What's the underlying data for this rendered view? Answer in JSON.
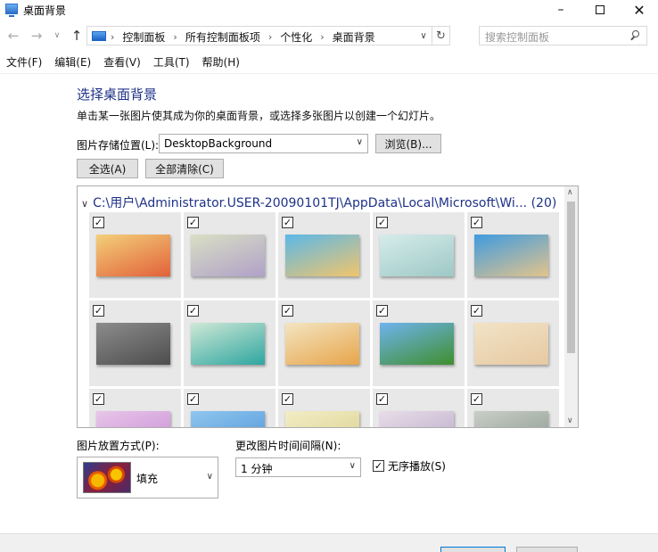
{
  "window": {
    "title": "桌面背景",
    "minimize": "–",
    "close": "✕"
  },
  "nav": {
    "back": "←",
    "forward": "→",
    "recent": "∨",
    "up": "↑",
    "crumbs": [
      "控制面板",
      "所有控制面板项",
      "个性化",
      "桌面背景"
    ],
    "separator": "›",
    "dropdown": "∨",
    "refresh": "↻",
    "search_placeholder": "搜索控制面板"
  },
  "menu": [
    "文件(F)",
    "编辑(E)",
    "查看(V)",
    "工具(T)",
    "帮助(H)"
  ],
  "main": {
    "title": "选择桌面背景",
    "subtitle": "单击某一张图片使其成为你的桌面背景，或选择多张图片以创建一个幻灯片。",
    "location_label": "图片存储位置(L):",
    "location_value": "DesktopBackground",
    "browse_label": "浏览(B)...",
    "select_all_label": "全选(A)",
    "clear_all_label": "全部清除(C)"
  },
  "gallery": {
    "group_chevron": "∨",
    "group_title": "C:\\用户\\Administrator.USER-20090101TJ\\AppData\\Local\\Microsoft\\Wi... (20)",
    "check_mark": "✓",
    "scroll_up": "∧",
    "scroll_down": "∨",
    "tiles": [
      {
        "colors": [
          "#f3d07a",
          "#e2613a"
        ]
      },
      {
        "colors": [
          "#d9dfc4",
          "#b0a1c8"
        ]
      },
      {
        "colors": [
          "#5bb8e8",
          "#f2c56b"
        ]
      },
      {
        "colors": [
          "#d5ecea",
          "#9ec8c6"
        ]
      },
      {
        "colors": [
          "#3f9be0",
          "#e3c48b"
        ]
      },
      {
        "colors": [
          "#8c8c8c",
          "#4d4d4d"
        ]
      },
      {
        "colors": [
          "#cfe8d6",
          "#2ea6a0"
        ]
      },
      {
        "colors": [
          "#f3e5c2",
          "#e7a54a"
        ]
      },
      {
        "colors": [
          "#6fb3ef",
          "#3f8f2e"
        ]
      },
      {
        "colors": [
          "#f2e3c6",
          "#e6c9a2"
        ]
      },
      {
        "colors": [
          "#e7c6e8",
          "#c98ad6"
        ]
      },
      {
        "colors": [
          "#8fc6ef",
          "#4d93d6"
        ]
      },
      {
        "colors": [
          "#f3edc6",
          "#d9cf8b"
        ]
      },
      {
        "colors": [
          "#e8dde8",
          "#b8a8c8"
        ]
      },
      {
        "colors": [
          "#c8cfc8",
          "#8a968a"
        ]
      }
    ]
  },
  "bottom": {
    "position_label": "图片放置方式(P):",
    "position_value": "填充",
    "interval_label": "更改图片时间间隔(N):",
    "interval_value": "1 分钟",
    "shuffle_label": "无序播放(S)",
    "shuffle_checked": true,
    "arrow": "∨"
  }
}
